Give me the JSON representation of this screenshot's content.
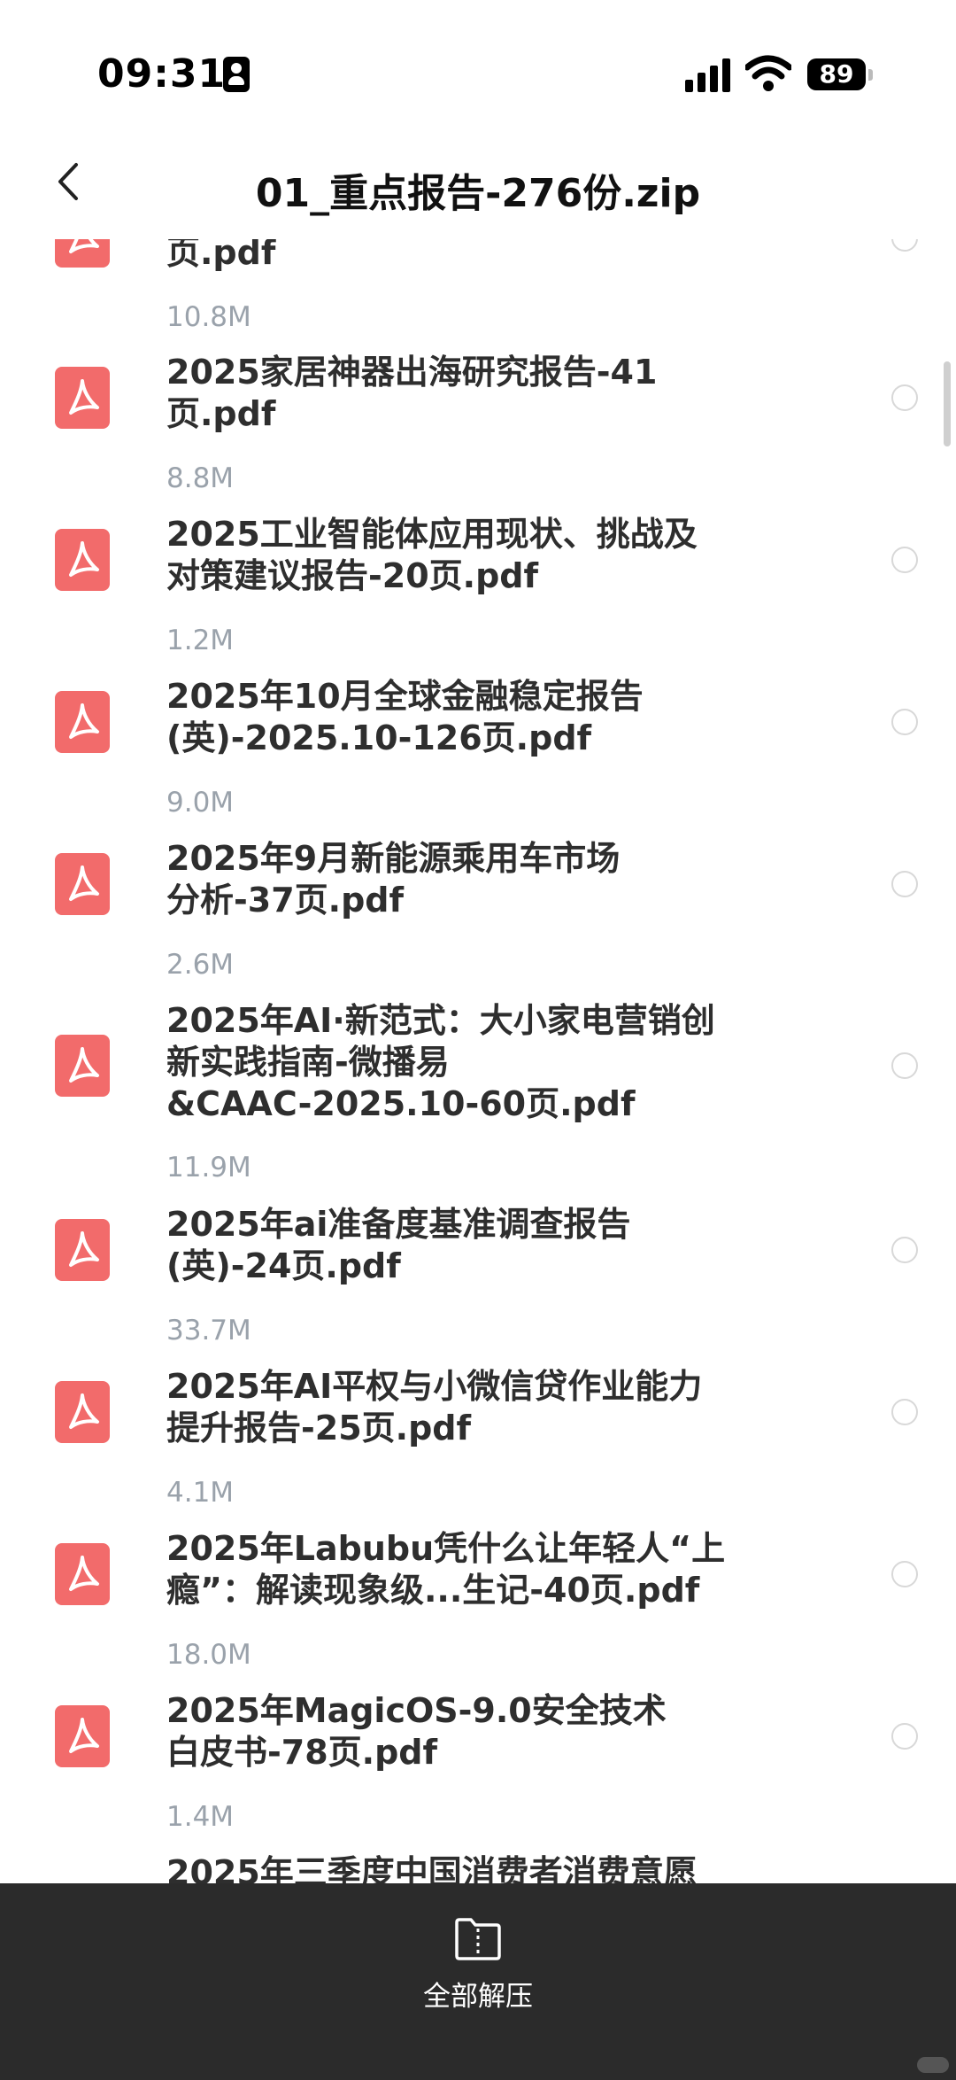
{
  "status_bar": {
    "time": "09:31",
    "battery": "89"
  },
  "nav": {
    "title": "01_重点报告-276份.zip"
  },
  "files": [
    {
      "name_line1": "",
      "name_line2": "页.pdf",
      "size": "10.8M"
    },
    {
      "name_line1": "2025家居神器出海研究报告-41",
      "name_line2": "页.pdf",
      "size": "8.8M"
    },
    {
      "name_line1": "2025工业智能体应用现状、挑战及",
      "name_line2": "对策建议报告-20页.pdf",
      "size": "1.2M"
    },
    {
      "name_line1": "2025年10月全球金融稳定报告",
      "name_line2": "(英)-2025.10-126页.pdf",
      "size": "9.0M"
    },
    {
      "name_line1": "2025年9月新能源乘用车市场",
      "name_line2": "分析-37页.pdf",
      "size": "2.6M"
    },
    {
      "name_line1": "2025年AI·新范式：大小家电营销创",
      "name_line2": "新实践指南-微播易",
      "name_line3": "&CAAC-2025.10-60页.pdf",
      "size": "11.9M"
    },
    {
      "name_line1": "2025年ai准备度基准调查报告",
      "name_line2": "(英)-24页.pdf",
      "size": "33.7M"
    },
    {
      "name_line1": "2025年AI平权与小微信贷作业能力",
      "name_line2": "提升报告-25页.pdf",
      "size": "4.1M"
    },
    {
      "name_line1": "2025年Labubu凭什么让年轻人“上",
      "name_line2": "瘾”：解读现象级...生记-40页.pdf",
      "size": "18.0M"
    },
    {
      "name_line1": "2025年MagicOS-9.0安全技术",
      "name_line2": "白皮书-78页.pdf",
      "size": "1.4M"
    },
    {
      "name_line1": "2025年三季度中国消费者消费意愿",
      "name_line2": "",
      "size": ""
    }
  ],
  "bottom": {
    "extract_all_label": "全部解压"
  },
  "icons": {
    "back": "chevron-left-icon",
    "pdf": "pdf-file-icon",
    "extract": "archive-extract-icon"
  },
  "colors": {
    "pdf_icon": "#f26b6b",
    "bottom_bar": "#2b2b2b",
    "size_text": "#9aa2ab"
  }
}
